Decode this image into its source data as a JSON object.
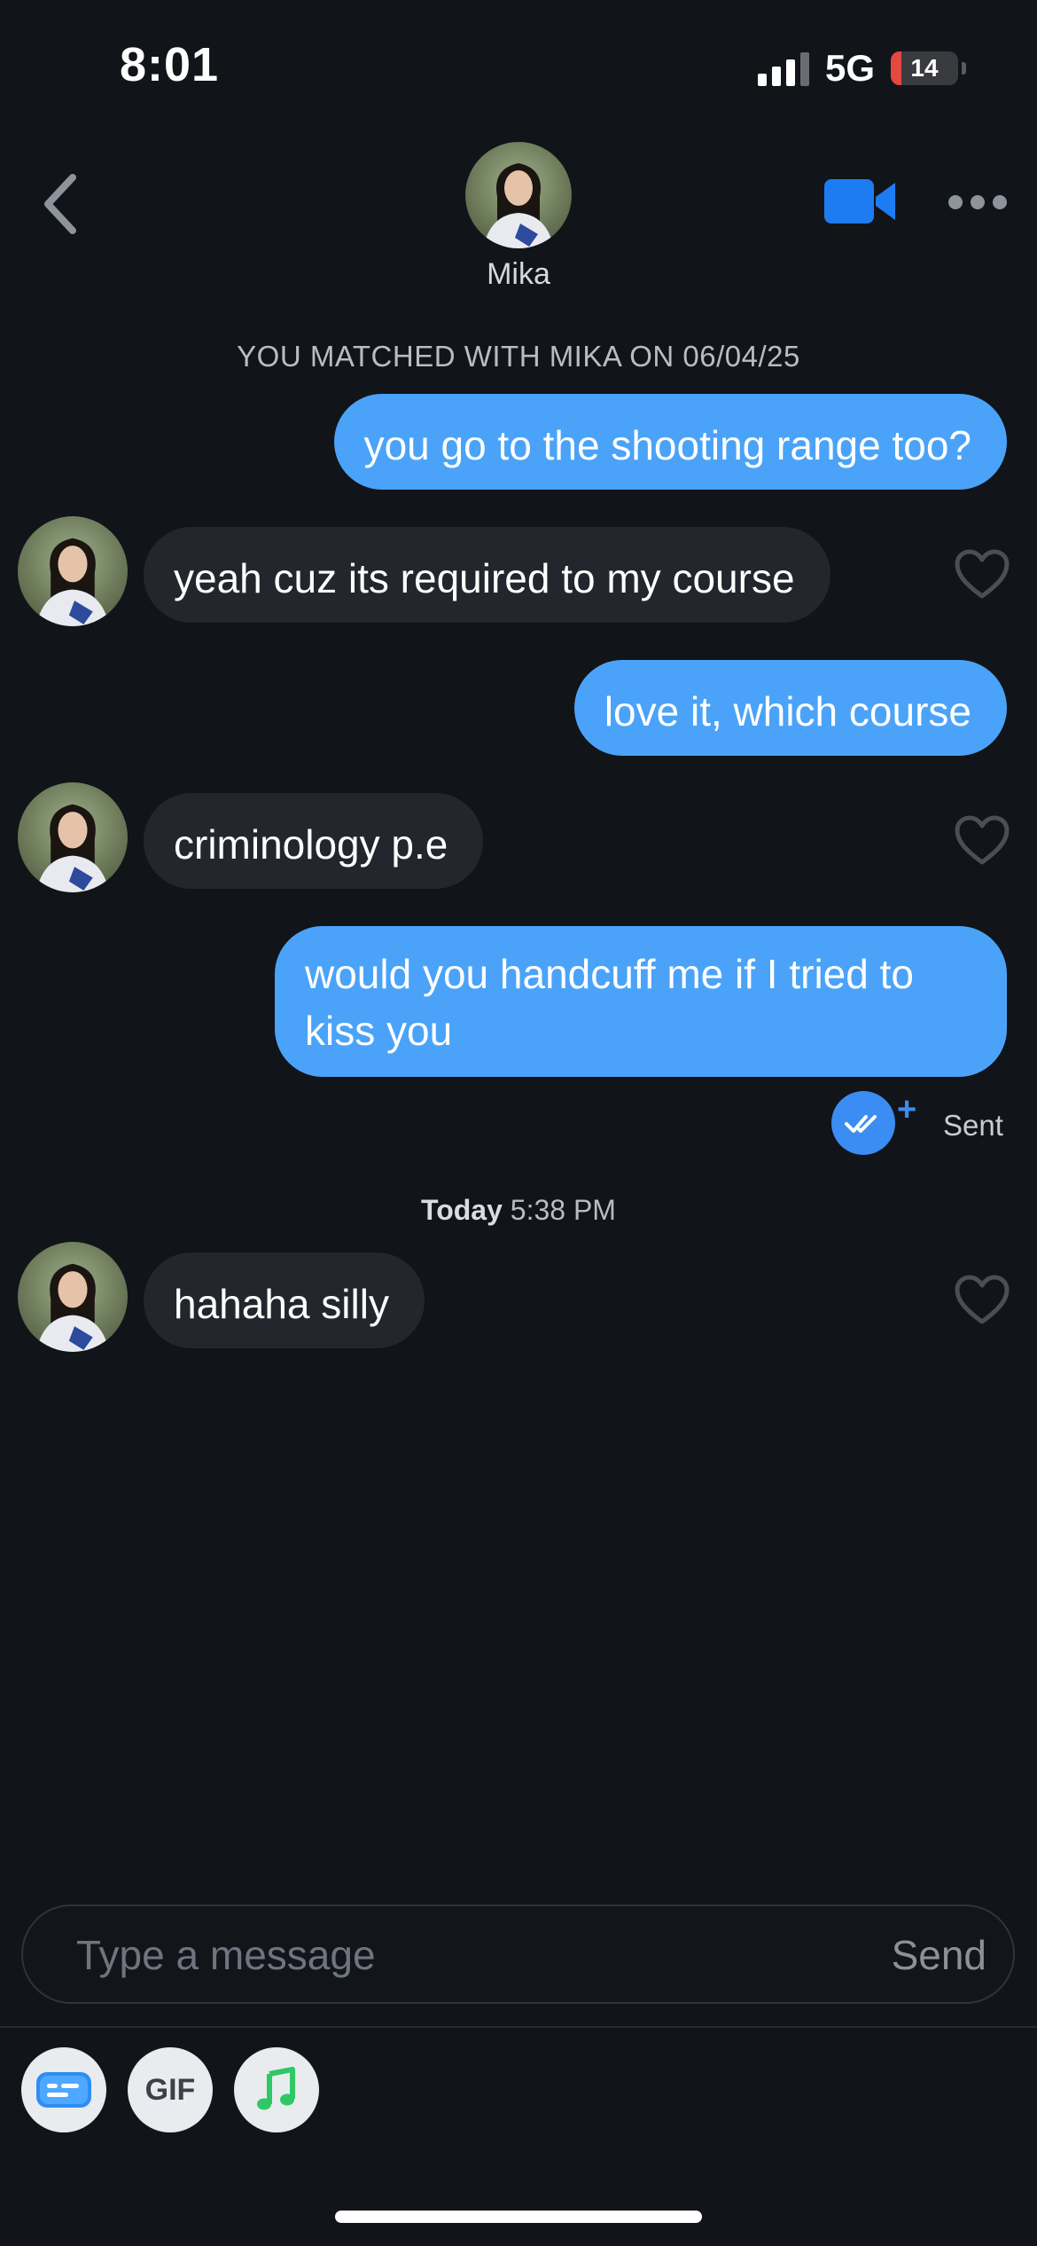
{
  "status_bar": {
    "time": "8:01",
    "network": "5G",
    "battery": "14"
  },
  "header": {
    "name": "Mika",
    "icons": [
      "back-icon",
      "avatar",
      "video-call-icon",
      "more-icon"
    ]
  },
  "match_banner": "YOU MATCHED WITH MIKA ON 06/04/25",
  "messages": [
    {
      "direction": "out",
      "text": "you go to the shooting range too?"
    },
    {
      "direction": "in",
      "text": "yeah cuz its required to my course"
    },
    {
      "direction": "out",
      "text": "love it, which course"
    },
    {
      "direction": "in",
      "text": "criminology p.e"
    },
    {
      "direction": "out",
      "text": "would you handcuff me if I tried to kiss you"
    },
    {
      "direction": "in",
      "text": "hahaha silly"
    }
  ],
  "delivery": {
    "plus": "+",
    "status": "Sent"
  },
  "timestamp": {
    "day": "Today",
    "time": "5:38 PM"
  },
  "composer": {
    "placeholder": "Type a message",
    "value": "",
    "send_label": "Send"
  },
  "toolbar": {
    "gif_label": "GIF",
    "icons": [
      "sticker-card-icon",
      "gif-icon",
      "music-note-icon"
    ]
  },
  "colors": {
    "background": "#111419",
    "outgoing_bubble": "#4aa3f8",
    "incoming_bubble": "#23262d",
    "accent": "#3b8cf3",
    "music_green": "#2ec866"
  }
}
